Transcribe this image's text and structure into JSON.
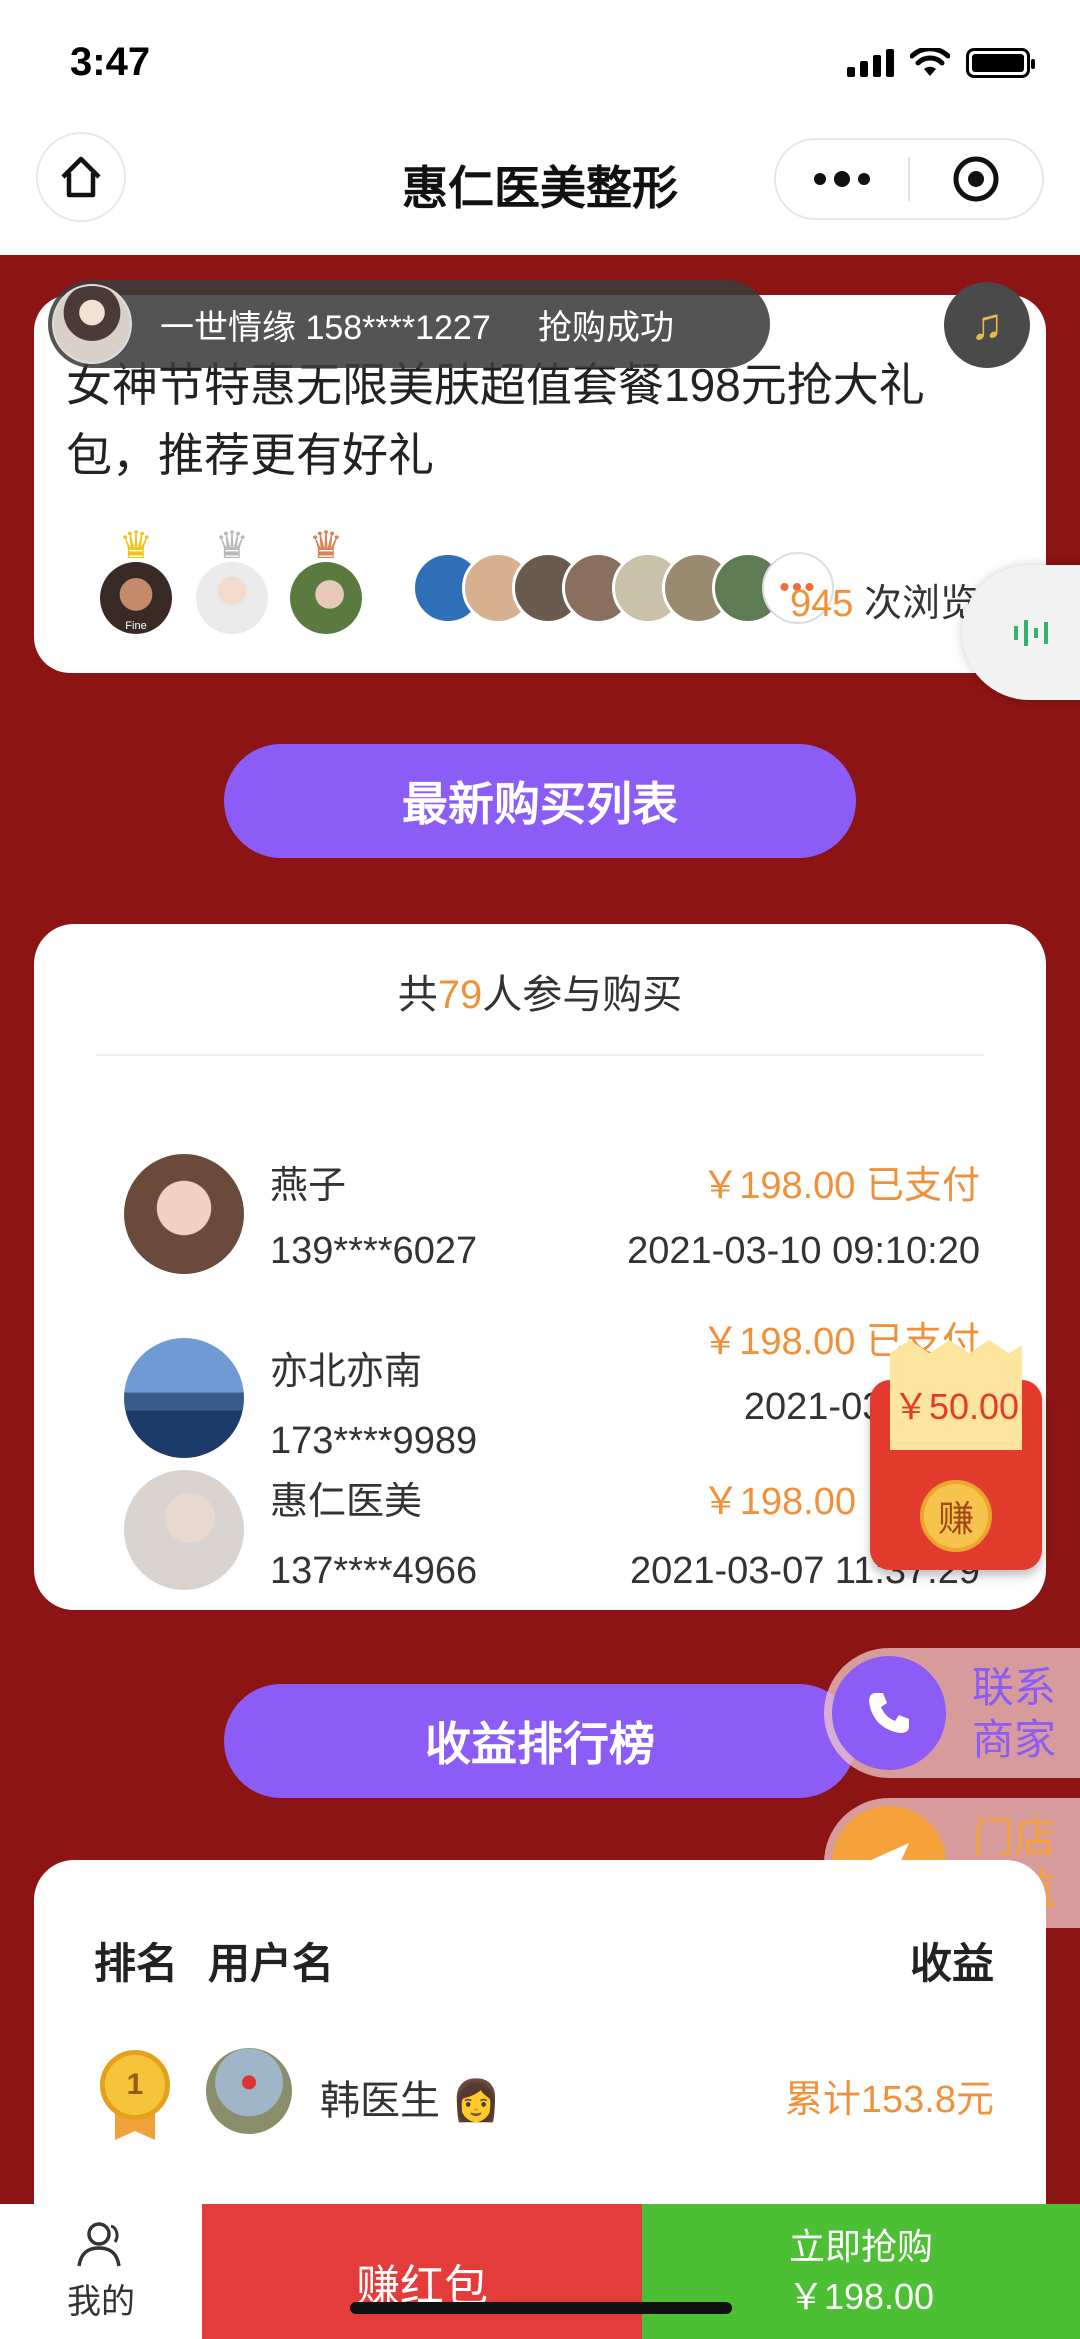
{
  "status_bar": {
    "time": "3:47"
  },
  "nav": {
    "title": "惠仁医美整形"
  },
  "top_card": {
    "title": "女神节特惠无限美肤超值套餐198元抢大礼包，推荐更有好礼",
    "views_count": "945",
    "views_label": "次浏览",
    "rank_avatar_caption": "Fine"
  },
  "notification": {
    "text": "一世情缘 158****1227     抢购成功"
  },
  "buttons": {
    "purchase_list": "最新购买列表",
    "earnings_rank": "收益排行榜"
  },
  "purchase": {
    "header_prefix": "共",
    "count": "79",
    "header_suffix": "人参与购买",
    "rows": [
      {
        "name": "燕子",
        "phone": "139****6027",
        "price": "￥198.00 已支付",
        "date": "2021-03-10 09:10:20"
      },
      {
        "name": "亦北亦南",
        "phone": "173****9989",
        "price": "￥198.00 已支付",
        "date": "2021-03-"
      },
      {
        "name": "惠仁医美",
        "phone": "137****4966",
        "price": "￥198.00",
        "date": "2021-03-07 11:37:29"
      }
    ]
  },
  "red_packet": {
    "amount": "￥50.00",
    "coin": "赚"
  },
  "floats": {
    "contact": "联系商家",
    "navigate": "门店导航"
  },
  "rank": {
    "col_rank": "排名",
    "col_user": "用户名",
    "col_earn": "收益",
    "first": {
      "number": "1",
      "name": "韩医生",
      "earn": "累计153.8元"
    }
  },
  "bottom_bar": {
    "me": "我的",
    "red": "赚红包",
    "buy": "立即抢购",
    "buy_price": "￥198.00"
  },
  "colors": {
    "primary_red": "#8c1414",
    "purple": "#8b5cf6",
    "orange": "#f0913a",
    "green": "#4cbf34"
  }
}
